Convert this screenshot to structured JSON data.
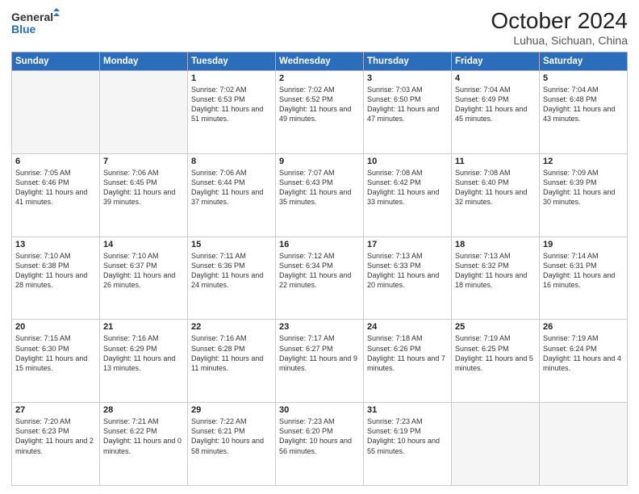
{
  "header": {
    "logo_line1": "General",
    "logo_line2": "Blue",
    "title": "October 2024",
    "subtitle": "Luhua, Sichuan, China"
  },
  "weekdays": [
    "Sunday",
    "Monday",
    "Tuesday",
    "Wednesday",
    "Thursday",
    "Friday",
    "Saturday"
  ],
  "weeks": [
    [
      {
        "day": "",
        "info": ""
      },
      {
        "day": "",
        "info": ""
      },
      {
        "day": "1",
        "info": "Sunrise: 7:02 AM\nSunset: 6:53 PM\nDaylight: 11 hours and 51 minutes."
      },
      {
        "day": "2",
        "info": "Sunrise: 7:02 AM\nSunset: 6:52 PM\nDaylight: 11 hours and 49 minutes."
      },
      {
        "day": "3",
        "info": "Sunrise: 7:03 AM\nSunset: 6:50 PM\nDaylight: 11 hours and 47 minutes."
      },
      {
        "day": "4",
        "info": "Sunrise: 7:04 AM\nSunset: 6:49 PM\nDaylight: 11 hours and 45 minutes."
      },
      {
        "day": "5",
        "info": "Sunrise: 7:04 AM\nSunset: 6:48 PM\nDaylight: 11 hours and 43 minutes."
      }
    ],
    [
      {
        "day": "6",
        "info": "Sunrise: 7:05 AM\nSunset: 6:46 PM\nDaylight: 11 hours and 41 minutes."
      },
      {
        "day": "7",
        "info": "Sunrise: 7:06 AM\nSunset: 6:45 PM\nDaylight: 11 hours and 39 minutes."
      },
      {
        "day": "8",
        "info": "Sunrise: 7:06 AM\nSunset: 6:44 PM\nDaylight: 11 hours and 37 minutes."
      },
      {
        "day": "9",
        "info": "Sunrise: 7:07 AM\nSunset: 6:43 PM\nDaylight: 11 hours and 35 minutes."
      },
      {
        "day": "10",
        "info": "Sunrise: 7:08 AM\nSunset: 6:42 PM\nDaylight: 11 hours and 33 minutes."
      },
      {
        "day": "11",
        "info": "Sunrise: 7:08 AM\nSunset: 6:40 PM\nDaylight: 11 hours and 32 minutes."
      },
      {
        "day": "12",
        "info": "Sunrise: 7:09 AM\nSunset: 6:39 PM\nDaylight: 11 hours and 30 minutes."
      }
    ],
    [
      {
        "day": "13",
        "info": "Sunrise: 7:10 AM\nSunset: 6:38 PM\nDaylight: 11 hours and 28 minutes."
      },
      {
        "day": "14",
        "info": "Sunrise: 7:10 AM\nSunset: 6:37 PM\nDaylight: 11 hours and 26 minutes."
      },
      {
        "day": "15",
        "info": "Sunrise: 7:11 AM\nSunset: 6:36 PM\nDaylight: 11 hours and 24 minutes."
      },
      {
        "day": "16",
        "info": "Sunrise: 7:12 AM\nSunset: 6:34 PM\nDaylight: 11 hours and 22 minutes."
      },
      {
        "day": "17",
        "info": "Sunrise: 7:13 AM\nSunset: 6:33 PM\nDaylight: 11 hours and 20 minutes."
      },
      {
        "day": "18",
        "info": "Sunrise: 7:13 AM\nSunset: 6:32 PM\nDaylight: 11 hours and 18 minutes."
      },
      {
        "day": "19",
        "info": "Sunrise: 7:14 AM\nSunset: 6:31 PM\nDaylight: 11 hours and 16 minutes."
      }
    ],
    [
      {
        "day": "20",
        "info": "Sunrise: 7:15 AM\nSunset: 6:30 PM\nDaylight: 11 hours and 15 minutes."
      },
      {
        "day": "21",
        "info": "Sunrise: 7:16 AM\nSunset: 6:29 PM\nDaylight: 11 hours and 13 minutes."
      },
      {
        "day": "22",
        "info": "Sunrise: 7:16 AM\nSunset: 6:28 PM\nDaylight: 11 hours and 11 minutes."
      },
      {
        "day": "23",
        "info": "Sunrise: 7:17 AM\nSunset: 6:27 PM\nDaylight: 11 hours and 9 minutes."
      },
      {
        "day": "24",
        "info": "Sunrise: 7:18 AM\nSunset: 6:26 PM\nDaylight: 11 hours and 7 minutes."
      },
      {
        "day": "25",
        "info": "Sunrise: 7:19 AM\nSunset: 6:25 PM\nDaylight: 11 hours and 5 minutes."
      },
      {
        "day": "26",
        "info": "Sunrise: 7:19 AM\nSunset: 6:24 PM\nDaylight: 11 hours and 4 minutes."
      }
    ],
    [
      {
        "day": "27",
        "info": "Sunrise: 7:20 AM\nSunset: 6:23 PM\nDaylight: 11 hours and 2 minutes."
      },
      {
        "day": "28",
        "info": "Sunrise: 7:21 AM\nSunset: 6:22 PM\nDaylight: 11 hours and 0 minutes."
      },
      {
        "day": "29",
        "info": "Sunrise: 7:22 AM\nSunset: 6:21 PM\nDaylight: 10 hours and 58 minutes."
      },
      {
        "day": "30",
        "info": "Sunrise: 7:23 AM\nSunset: 6:20 PM\nDaylight: 10 hours and 56 minutes."
      },
      {
        "day": "31",
        "info": "Sunrise: 7:23 AM\nSunset: 6:19 PM\nDaylight: 10 hours and 55 minutes."
      },
      {
        "day": "",
        "info": ""
      },
      {
        "day": "",
        "info": ""
      }
    ]
  ]
}
